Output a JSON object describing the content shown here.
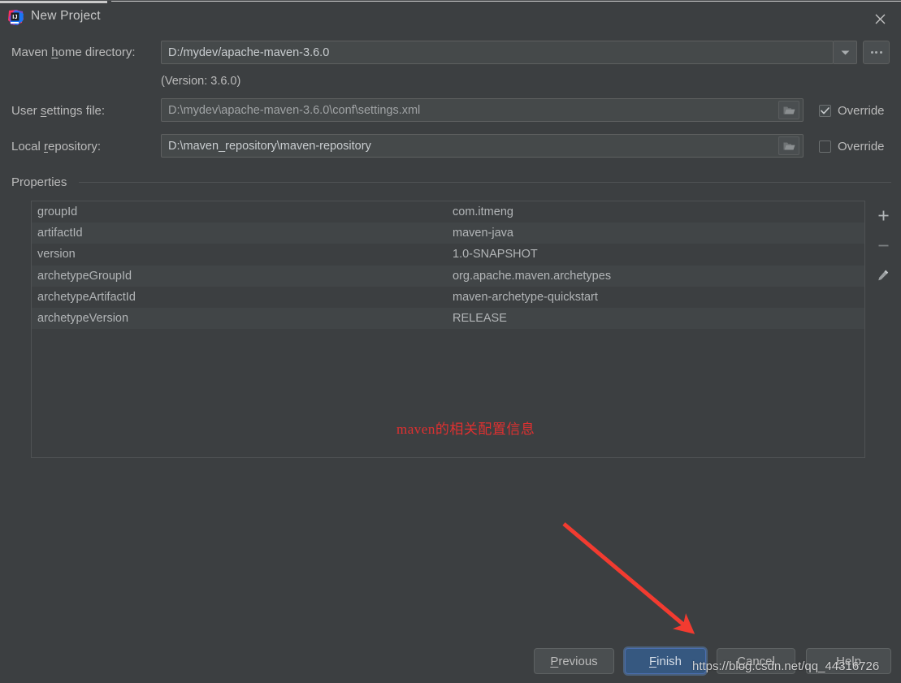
{
  "window": {
    "title": "New Project",
    "logo_icon": "intellij-idea-logo",
    "close_icon": "close-icon"
  },
  "form": {
    "maven_home": {
      "label_prefix": "Maven ",
      "label_mnemonic": "h",
      "label_suffix": "ome directory:",
      "value": "D:/mydev/apache-maven-3.6.0",
      "dropdown_icon": "chevron-down-icon",
      "browse_icon": "ellipsis-icon",
      "version_note": "(Version: 3.6.0)"
    },
    "user_settings": {
      "label_prefix": "User ",
      "label_mnemonic": "s",
      "label_suffix": "ettings file:",
      "value": "D:\\mydev\\apache-maven-3.6.0\\conf\\settings.xml",
      "folder_icon": "folder-icon",
      "override_label": "Override",
      "override_checked": true
    },
    "local_repository": {
      "label_prefix": "Local ",
      "label_mnemonic": "r",
      "label_suffix": "epository:",
      "value": "D:\\maven_repository\\maven-repository",
      "folder_icon": "folder-icon",
      "override_label": "Override",
      "override_checked": false
    }
  },
  "properties": {
    "group_label": "Properties",
    "rows": [
      {
        "key": "groupId",
        "value": "com.itmeng"
      },
      {
        "key": "artifactId",
        "value": "maven-java"
      },
      {
        "key": "version",
        "value": "1.0-SNAPSHOT"
      },
      {
        "key": "archetypeGroupId",
        "value": "org.apache.maven.archetypes"
      },
      {
        "key": "archetypeArtifactId",
        "value": "maven-archetype-quickstart"
      },
      {
        "key": "archetypeVersion",
        "value": "RELEASE"
      }
    ],
    "toolbar": {
      "add_icon": "plus-icon",
      "remove_icon": "minus-icon",
      "edit_icon": "pencil-icon"
    }
  },
  "annotation": {
    "text": "maven的相关配置信息",
    "color": "#e03030",
    "arrow_icon": "red-arrow-icon",
    "arrow_color": "#f23b30"
  },
  "footer": {
    "previous": {
      "prefix": "",
      "mnemonic": "P",
      "suffix": "revious"
    },
    "finish": {
      "prefix": "",
      "mnemonic": "F",
      "suffix": "inish"
    },
    "cancel": {
      "prefix": "",
      "mnemonic": "C",
      "suffix": "ancel"
    },
    "help": {
      "prefix": "",
      "mnemonic": "H",
      "suffix": "elp"
    }
  },
  "watermark": {
    "text": "https://blog.csdn.net/qq_44316726"
  },
  "theme": {
    "background": "#3c3f41",
    "field_background": "#45494a",
    "primary_button": "#365880",
    "row_alt": "#414547"
  }
}
